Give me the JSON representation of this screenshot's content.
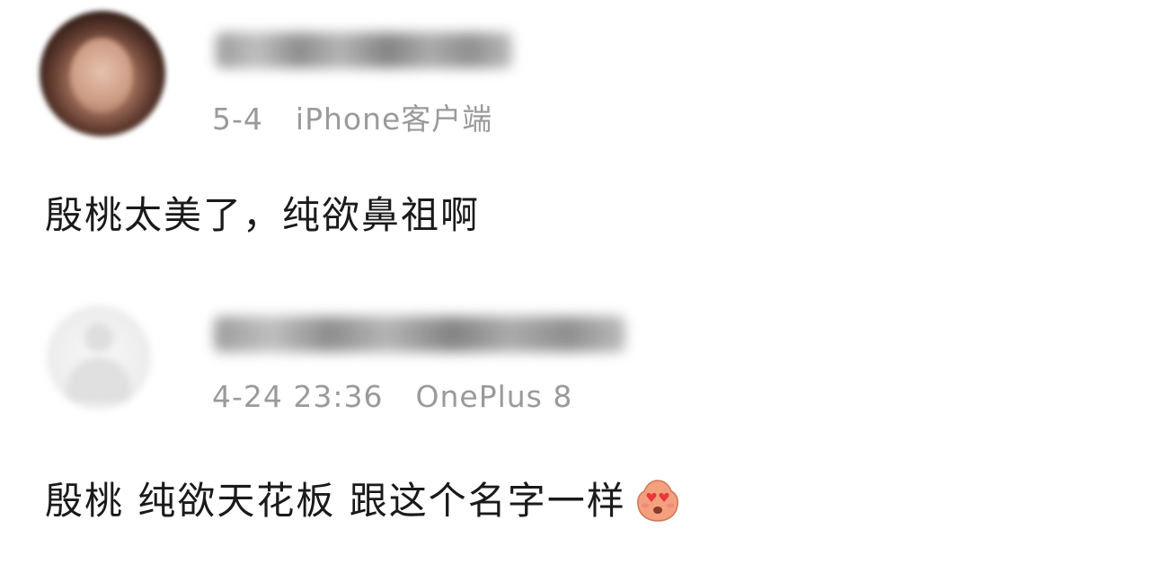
{
  "comments": [
    {
      "date": "5-4",
      "device": "iPhone客户端",
      "text": "殷桃太美了，纯欲鼻祖啊"
    },
    {
      "date": "4-24 23:36",
      "device": "OnePlus 8",
      "text": "殷桃 纯欲天花板 跟这个名字一样",
      "emoji": "heart-eyes-emoji"
    }
  ],
  "colors": {
    "meta_text": "#9a9a9a",
    "body_text": "#1a1a1a",
    "emoji_heart": "#e8363a"
  }
}
